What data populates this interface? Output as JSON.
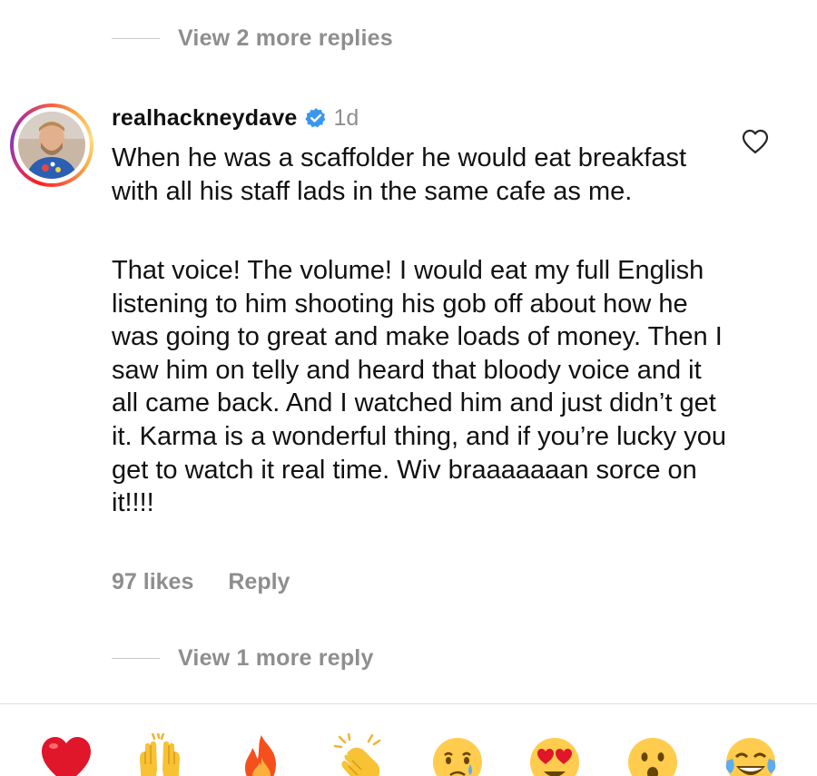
{
  "top_view_replies": {
    "label": "View 2 more replies"
  },
  "comment": {
    "username": "realhackneydave",
    "time": "1d",
    "paragraphs": [
      "When he was a scaffolder he would eat breakfast with all his staff lads in the same cafe as me.",
      "That voice! The volume! I would eat my full English listening to him shooting his gob off about how he was going to great and make loads of money. Then I saw him on telly and heard that bloody voice and it all came back. And I watched him and just didn’t get it.  Karma is  a wonderful thing, and if you’re lucky you get to watch it real time. Wiv braaaaaaan sorce on it!!!!"
    ],
    "likes": "97 likes",
    "reply_label": "Reply"
  },
  "bottom_view_replies": {
    "label": "View 1 more reply"
  },
  "icons": {
    "verified": "verified-badge-icon",
    "like": "heart-outline-icon"
  },
  "colors": {
    "verified_blue": "#3897f0",
    "muted_text": "#8e8e8e",
    "heart_red": "#e0162b"
  },
  "emoji_bar": [
    "heart",
    "raised-hands",
    "fire",
    "clapping-hands",
    "crying-face",
    "heart-eyes",
    "surprised-face",
    "tears-of-joy"
  ]
}
